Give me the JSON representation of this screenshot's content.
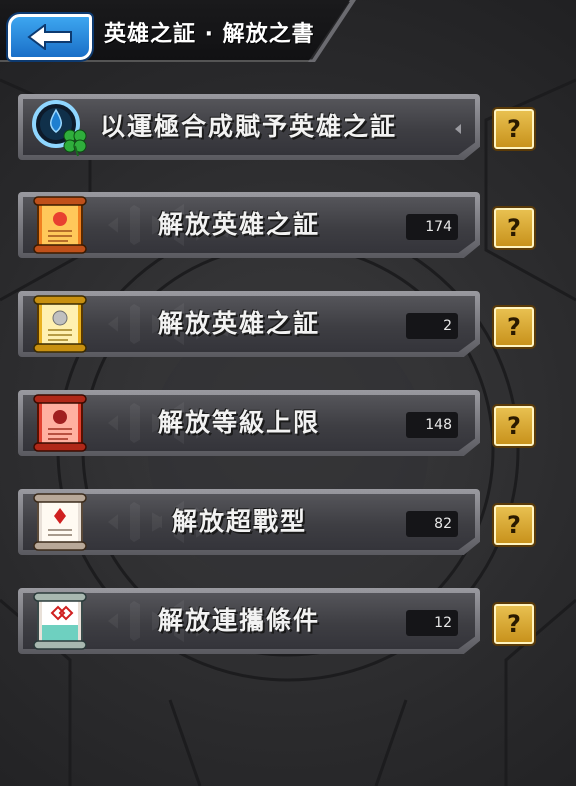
{
  "header": {
    "title": "英雄之証 · 解放之書",
    "back_icon": "back-arrow-icon"
  },
  "colors": {
    "header_bg": "#111113",
    "back_button": "#2a86dc",
    "help_button": "#d9a632",
    "row_bg": "#45454a",
    "count_bg": "#151518"
  },
  "rows": [
    {
      "label": "以運極合成賦予英雄之証",
      "count": "",
      "icon": "luck-clover-icon"
    },
    {
      "label": "解放英雄之証",
      "count": "174",
      "icon": "scroll-orange-icon"
    },
    {
      "label": "解放英雄之証",
      "count": "2",
      "icon": "scroll-gold-icon"
    },
    {
      "label": "解放等級上限",
      "count": "148",
      "icon": "scroll-red-icon"
    },
    {
      "label": "解放超戰型",
      "count": "82",
      "icon": "scroll-white-icon"
    },
    {
      "label": "解放連攜條件",
      "count": "12",
      "icon": "scroll-teal-icon"
    }
  ],
  "help_label": "?"
}
